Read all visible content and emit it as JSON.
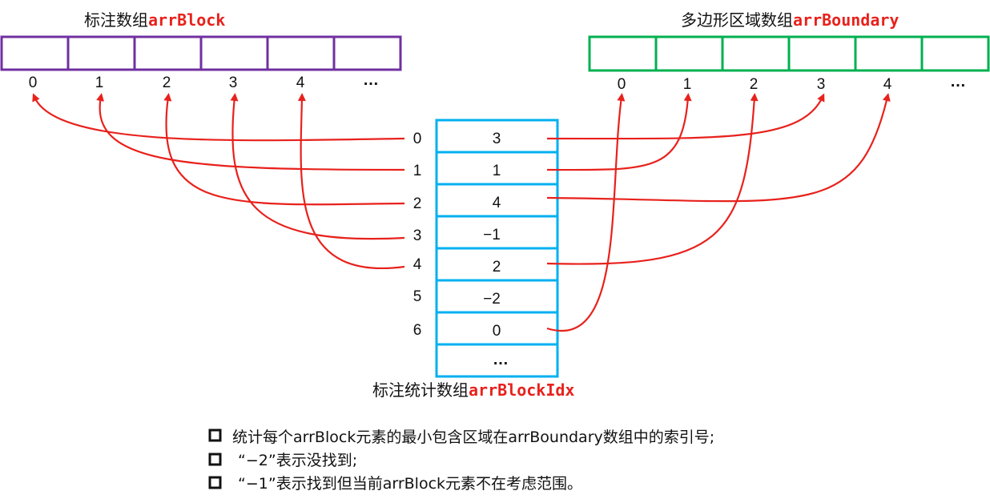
{
  "arrBlock": {
    "title_cn": "标注数组",
    "title_var": "arrBlock",
    "border_color": "#7030a0",
    "indices": [
      "0",
      "1",
      "2",
      "3",
      "4",
      "…"
    ]
  },
  "arrBoundary": {
    "title_cn": "多边形区域数组",
    "title_var": "arrBoundary",
    "border_color": "#00b050",
    "indices": [
      "0",
      "1",
      "2",
      "3",
      "4",
      "…"
    ]
  },
  "arrBlockIdx": {
    "title_cn": "标注统计数组",
    "title_var": "arrBlockIdx",
    "border_color": "#00b0f0",
    "row_indices": [
      "0",
      "1",
      "2",
      "3",
      "4",
      "5",
      "6"
    ],
    "values": [
      "3",
      "1",
      "4",
      "−1",
      "2",
      "−2",
      "0",
      "…"
    ]
  },
  "arrow_color": "#e8211c",
  "mappings": {
    "block_to_idx": [
      {
        "from_block": 0,
        "to_row": 0
      },
      {
        "from_block": 1,
        "to_row": 1
      },
      {
        "from_block": 2,
        "to_row": 2
      },
      {
        "from_block": 3,
        "to_row": 3
      },
      {
        "from_block": 4,
        "to_row": 4
      }
    ],
    "idx_to_boundary": [
      {
        "from_row": 0,
        "to_boundary": 3
      },
      {
        "from_row": 1,
        "to_boundary": 1
      },
      {
        "from_row": 2,
        "to_boundary": 4
      },
      {
        "from_row": 4,
        "to_boundary": 2
      },
      {
        "from_row": 6,
        "to_boundary": 0
      }
    ]
  },
  "notes": [
    "统计每个arrBlock元素的最小包含区域在arrBoundary数组中的索引号;",
    "“−2”表示没找到;",
    "“−1”表示找到但当前arrBlock元素不在考虑范围。"
  ]
}
